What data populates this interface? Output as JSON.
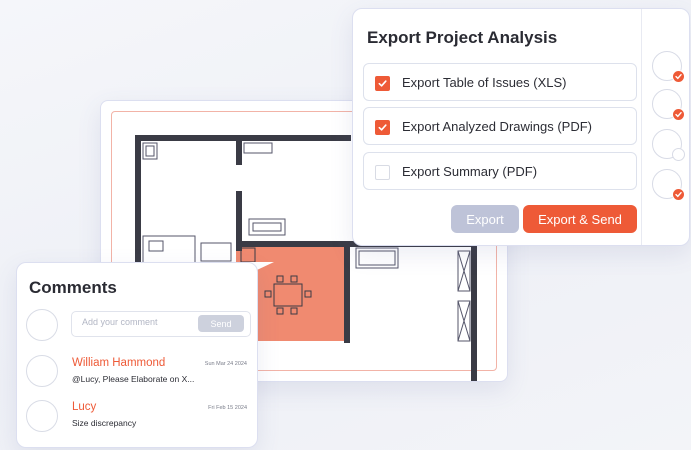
{
  "export_panel": {
    "title": "Export Project Analysis",
    "options": [
      {
        "label": "Export Table of Issues (XLS)",
        "checked": true
      },
      {
        "label": "Export Analyzed Drawings (PDF)",
        "checked": true
      },
      {
        "label": "Export Summary (PDF)",
        "checked": false
      }
    ],
    "export_label": "Export",
    "export_send_label": "Export & Send",
    "status_indicators": [
      "complete",
      "complete",
      "pending",
      "complete"
    ]
  },
  "comments": {
    "title": "Comments",
    "input_placeholder": "Add your comment",
    "send_label": "Send",
    "items": [
      {
        "author": "William Hammond",
        "date": "Sun Mar 24 2024",
        "text": "@Lucy, Please Elaborate on X..."
      },
      {
        "author": "Lucy",
        "date": "Fri Feb 15 2024",
        "text": "Size discrepancy"
      }
    ]
  },
  "colors": {
    "accent": "#ee5a37",
    "highlight_room": "#f08a70",
    "disabled_button": "#bec3d8",
    "wall": "#3a3b45"
  }
}
